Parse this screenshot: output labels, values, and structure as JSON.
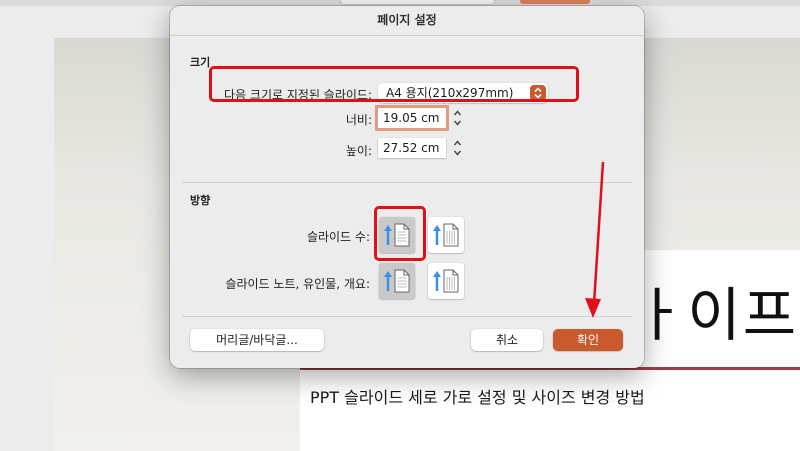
{
  "dialog": {
    "title": "페이지 설정",
    "size_section": {
      "label": "크기",
      "slide_size_label": "다음 크기로 지정된 슬라이드:",
      "slide_size_value": "A4 용지(210x297mm)",
      "width_label": "너비:",
      "width_value": "19.05 cm",
      "height_label": "높이:",
      "height_value": "27.52 cm"
    },
    "orientation_section": {
      "label": "방향",
      "slides_label": "슬라이드 수:",
      "notes_label": "슬라이드 노트, 유인물, 개요:"
    },
    "buttons": {
      "header_footer": "머리글/바닥글...",
      "cancel": "취소",
      "ok": "확인"
    }
  },
  "slide": {
    "heading_partial": "ㅏ이프",
    "subtitle": "PPT 슬라이드 세로 가로 설정 및 사이즈 변경 방법"
  },
  "colors": {
    "accent": "#c85a2e",
    "annotation_red": "#e0101a",
    "icon_blue": "#3d8fe0",
    "slide_line": "#a13a4a"
  },
  "icons": {
    "portrait": "portrait-page-icon",
    "landscape": "landscape-page-icon",
    "stepper": "stepper-arrows-icon",
    "dropdown": "chevron-updown-icon"
  }
}
